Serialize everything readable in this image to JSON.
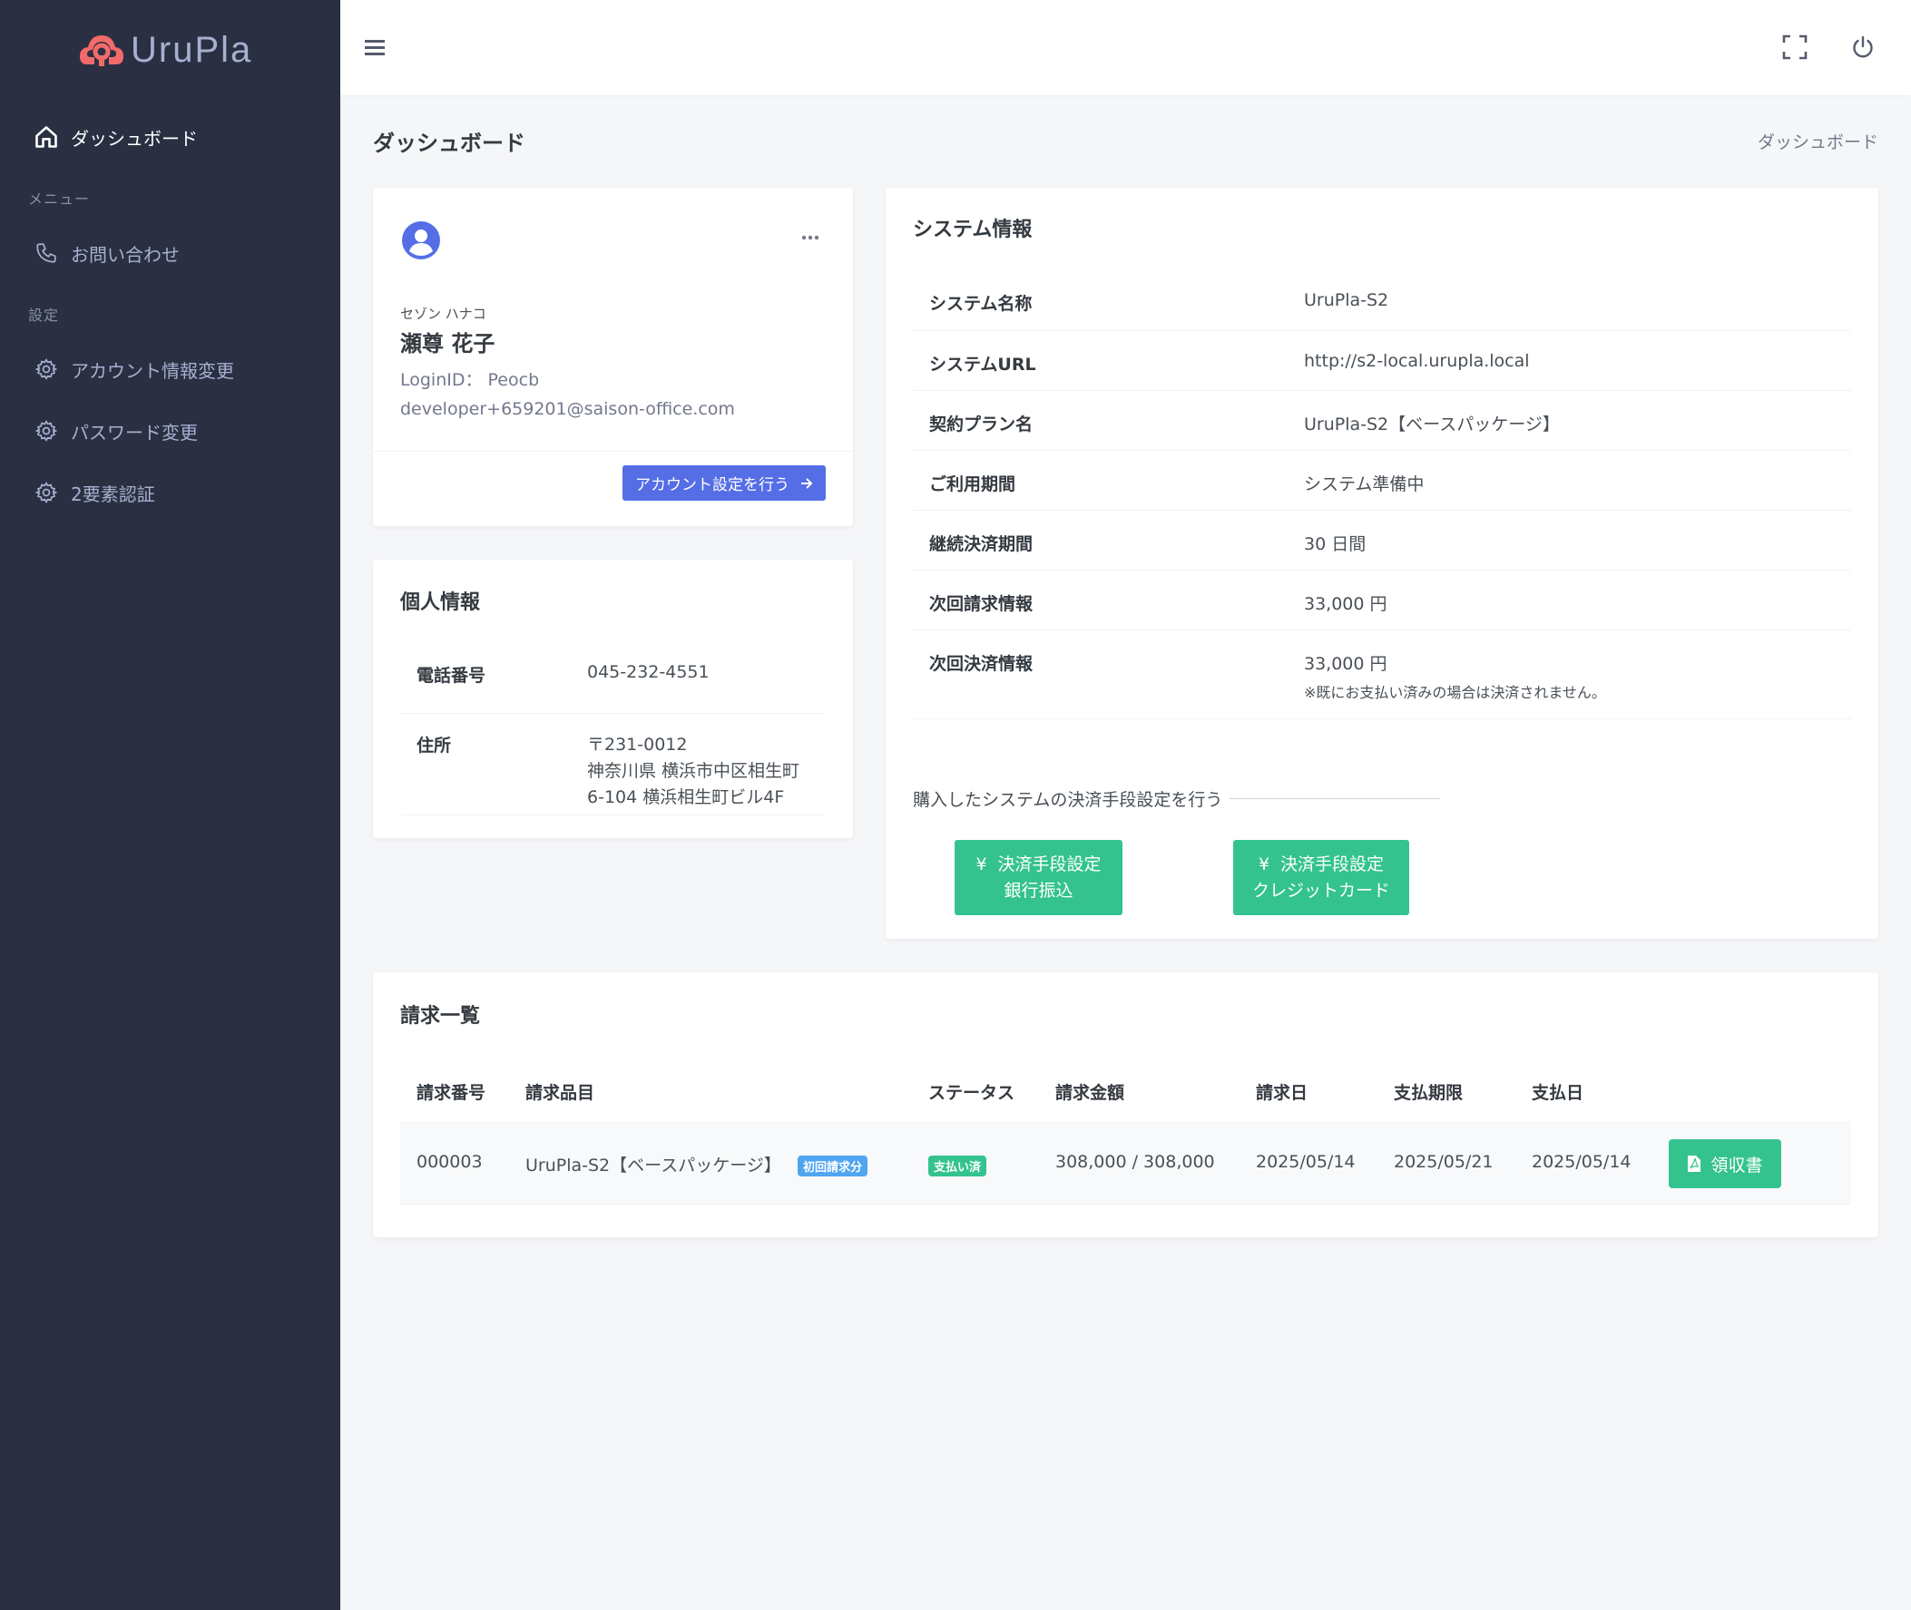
{
  "brand": {
    "name": "UruPla",
    "accent": "#f46a6a"
  },
  "sidebar": {
    "dashboard": "ダッシュボード",
    "menu_title": "メニュー",
    "contact": "お問い合わせ",
    "settings_title": "設定",
    "account_change": "アカウント情報変更",
    "password_change": "パスワード変更",
    "two_factor": "2要素認証"
  },
  "page": {
    "title": "ダッシュボード",
    "breadcrumb": "ダッシュボード"
  },
  "profile": {
    "kana": "セゾン ハナコ",
    "name": "瀬尊 花子",
    "login_id": "LoginID： Peocb",
    "email": "developer+659201@saison-office.com",
    "account_button": "アカウント設定を行う"
  },
  "personal": {
    "title": "個人情報",
    "phone_label": "電話番号",
    "phone": "045-232-4551",
    "address_label": "住所",
    "address_zip": "〒231-0012",
    "address_line1": "神奈川県 横浜市中区相生町",
    "address_line2": "6-104 横浜相生町ビル4F"
  },
  "system": {
    "title": "システム情報",
    "rows": [
      {
        "label": "システム名称",
        "value": "UruPla-S2"
      },
      {
        "label": "システムURL",
        "value": "http://s2-local.urupla.local"
      },
      {
        "label": "契約プラン名",
        "value": "UruPla-S2【ベースパッケージ】"
      },
      {
        "label": "ご利用期間",
        "value": "システム準備中"
      },
      {
        "label": "継続決済期間",
        "value": "30 日間"
      },
      {
        "label": "次回請求情報",
        "value": "33,000 円"
      },
      {
        "label": "次回決済情報",
        "value": "33,000 円"
      }
    ],
    "note": "※既にお支払い済みの場合は決済されません。",
    "payment_heading": "購入したシステムの決済手段設定を行う",
    "bank_btn_line1": "決済手段設定",
    "bank_btn_line2": "銀行振込",
    "card_btn_line1": "決済手段設定",
    "card_btn_line2": "クレジットカード",
    "yen_symbol": "¥"
  },
  "billing": {
    "title": "請求一覧",
    "headers": [
      "請求番号",
      "請求品目",
      "ステータス",
      "請求金額",
      "請求日",
      "支払期限",
      "支払日"
    ],
    "row": {
      "number": "000003",
      "item": "UruPla-S2【ベースパッケージ】",
      "item_badge": "初回請求分",
      "status": "支払い済",
      "amount": "308,000 / 308,000",
      "billed_date": "2025/05/14",
      "due_date": "2025/05/21",
      "paid_date": "2025/05/14",
      "receipt_button": "領収書"
    }
  }
}
